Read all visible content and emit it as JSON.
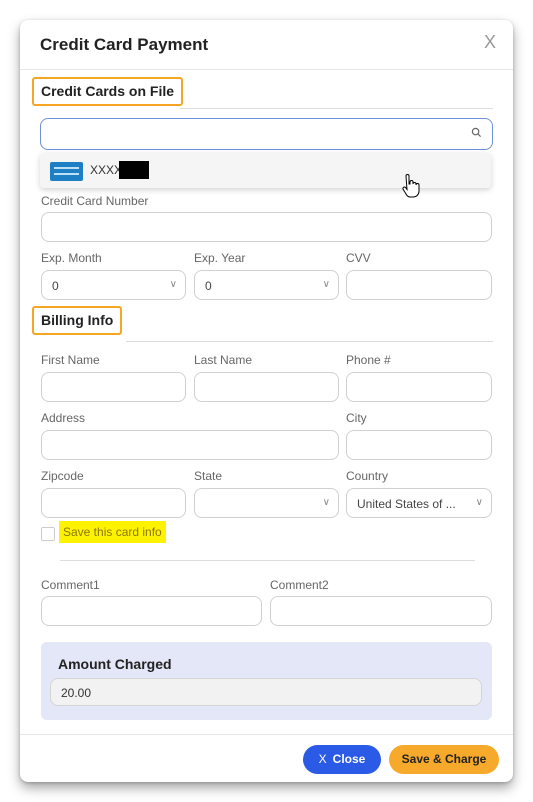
{
  "dialog": {
    "title": "Credit Card Payment",
    "close_glyph": "X"
  },
  "cards_on_file": {
    "heading": "Credit Cards on File",
    "search_value": "",
    "card_prefix": "XXXX",
    "card_icon": "amex-card-icon"
  },
  "card": {
    "number_label": "Credit Card Number",
    "number_value": "",
    "exp_month_label": "Exp. Month",
    "exp_month_value": "0",
    "exp_year_label": "Exp. Year",
    "exp_year_value": "0",
    "cvv_label": "CVV",
    "cvv_value": ""
  },
  "billing": {
    "heading": "Billing Info",
    "first_name_label": "First Name",
    "last_name_label": "Last Name",
    "phone_label": "Phone #",
    "address_label": "Address",
    "city_label": "City",
    "zipcode_label": "Zipcode",
    "state_label": "State",
    "state_value": "",
    "country_label": "Country",
    "country_value": "United States of ...",
    "save_card_label": "Save this card info",
    "save_card_checked": false
  },
  "comments": {
    "comment1_label": "Comment1",
    "comment2_label": "Comment2"
  },
  "amount": {
    "label": "Amount Charged",
    "value": "20.00"
  },
  "buttons": {
    "close_label": "Close",
    "close_glyph": "X",
    "save_label": "Save & Charge"
  },
  "colors": {
    "highlight_border": "#f5a623",
    "highlight_fill": "#fff200",
    "close_button": "#2a5ae6",
    "save_button": "#f7a92b",
    "amount_panel": "#e3e7f7"
  }
}
